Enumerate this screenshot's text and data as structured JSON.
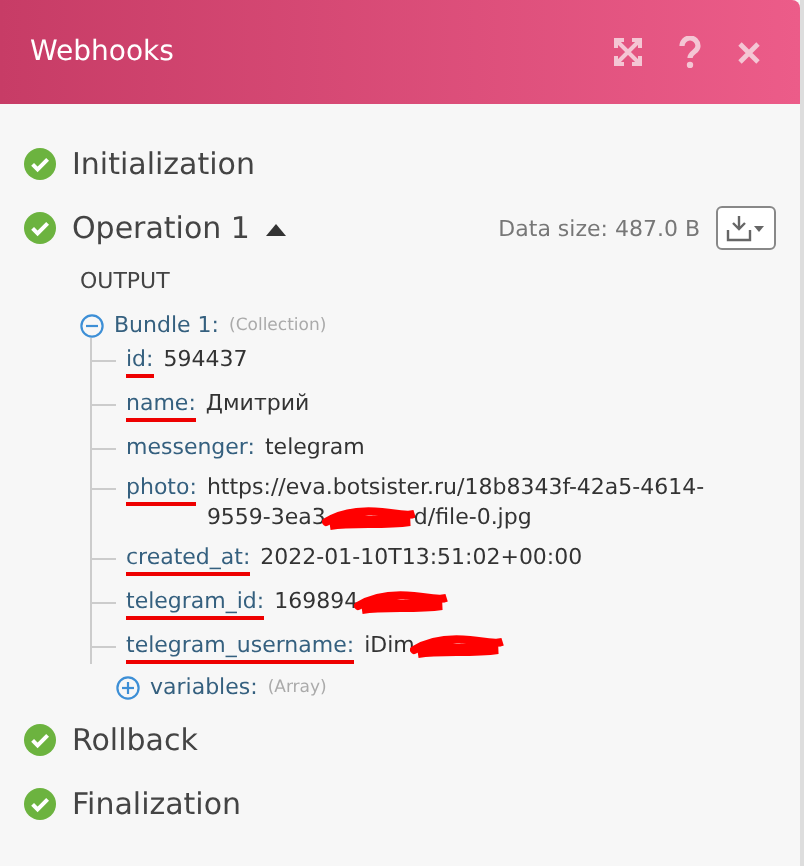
{
  "window": {
    "title": "Webhooks"
  },
  "steps": [
    {
      "label": "Initialization",
      "done": true
    },
    {
      "label": "Operation 1",
      "done": true,
      "expanded": true,
      "data_size": "Data size: 487.0 B",
      "output": {
        "heading": "OUTPUT",
        "bundle": {
          "label": "Bundle 1:",
          "type": "(Collection)",
          "expanded": true,
          "fields": [
            {
              "key": "id:",
              "underlined": true,
              "value": [
                {
                  "kind": "text",
                  "text": "594437"
                }
              ]
            },
            {
              "key": "name:",
              "underlined": true,
              "value": [
                {
                  "kind": "text",
                  "text": "Дмитрий"
                }
              ]
            },
            {
              "key": "messenger:",
              "underlined": false,
              "value": [
                {
                  "kind": "text",
                  "text": "telegram"
                }
              ]
            },
            {
              "key": "photo:",
              "underlined": true,
              "value": [
                {
                  "kind": "text",
                  "text": "https://eva.botsister.ru/18b8343f-42a5-4614-"
                },
                {
                  "kind": "break"
                },
                {
                  "kind": "text",
                  "text": "9559-3ea3"
                },
                {
                  "kind": "redaction"
                },
                {
                  "kind": "text",
                  "text": "d/file-0.jpg"
                }
              ]
            },
            {
              "key": "created_at:",
              "underlined": true,
              "value": [
                {
                  "kind": "text",
                  "text": "2022-01-10T13:51:02+00:00"
                }
              ]
            },
            {
              "key": "telegram_id:",
              "underlined": true,
              "value": [
                {
                  "kind": "text",
                  "text": "169894"
                },
                {
                  "kind": "redaction"
                }
              ]
            },
            {
              "key": "telegram_username:",
              "underlined": true,
              "value": [
                {
                  "kind": "text",
                  "text": "iDim"
                },
                {
                  "kind": "redaction"
                }
              ]
            }
          ]
        },
        "extra": {
          "label": "variables:",
          "type": "(Array)",
          "expanded": false
        }
      }
    },
    {
      "label": "Rollback",
      "done": true
    },
    {
      "label": "Finalization",
      "done": true
    }
  ]
}
